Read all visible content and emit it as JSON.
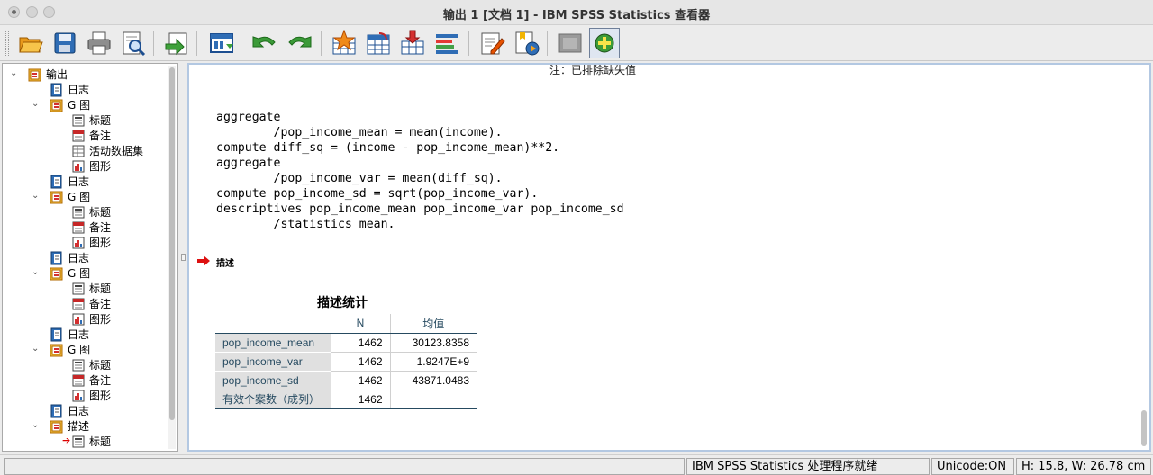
{
  "window": {
    "title": "输出 1 [文档 1] - IBM SPSS Statistics 查看器"
  },
  "toolbar": {
    "buttons": [
      {
        "name": "open-icon"
      },
      {
        "name": "save-icon"
      },
      {
        "name": "print-icon"
      },
      {
        "name": "print-preview-icon"
      },
      {
        "name": "export-icon"
      },
      {
        "name": "recall-dialog-icon"
      },
      {
        "name": "undo-icon"
      },
      {
        "name": "redo-icon"
      },
      {
        "name": "goto-data-icon"
      },
      {
        "name": "goto-case-icon"
      },
      {
        "name": "insert-variable-icon"
      },
      {
        "name": "variables-icon"
      },
      {
        "name": "edit-output-icon"
      },
      {
        "name": "run-script-icon"
      },
      {
        "name": "hide-icon"
      },
      {
        "name": "designate-window-icon"
      }
    ]
  },
  "tree": {
    "items": [
      {
        "label": "输出",
        "level": 0,
        "icon": "output-book-icon",
        "expanded": true
      },
      {
        "label": "日志",
        "level": 1,
        "icon": "log-icon"
      },
      {
        "label": "G 图",
        "level": 1,
        "icon": "output-book-icon",
        "expanded": true
      },
      {
        "label": "标题",
        "level": 2,
        "icon": "title-icon"
      },
      {
        "label": "备注",
        "level": 2,
        "icon": "notes-icon"
      },
      {
        "label": "活动数据集",
        "level": 2,
        "icon": "dataset-icon"
      },
      {
        "label": "图形",
        "level": 2,
        "icon": "chart-icon"
      },
      {
        "label": "日志",
        "level": 1,
        "icon": "log-icon"
      },
      {
        "label": "G 图",
        "level": 1,
        "icon": "output-book-icon",
        "expanded": true
      },
      {
        "label": "标题",
        "level": 2,
        "icon": "title-icon"
      },
      {
        "label": "备注",
        "level": 2,
        "icon": "notes-icon"
      },
      {
        "label": "图形",
        "level": 2,
        "icon": "chart-icon"
      },
      {
        "label": "日志",
        "level": 1,
        "icon": "log-icon"
      },
      {
        "label": "G 图",
        "level": 1,
        "icon": "output-book-icon",
        "expanded": true
      },
      {
        "label": "标题",
        "level": 2,
        "icon": "title-icon"
      },
      {
        "label": "备注",
        "level": 2,
        "icon": "notes-icon"
      },
      {
        "label": "图形",
        "level": 2,
        "icon": "chart-icon"
      },
      {
        "label": "日志",
        "level": 1,
        "icon": "log-icon"
      },
      {
        "label": "G 图",
        "level": 1,
        "icon": "output-book-icon",
        "expanded": true
      },
      {
        "label": "标题",
        "level": 2,
        "icon": "title-icon"
      },
      {
        "label": "备注",
        "level": 2,
        "icon": "notes-icon"
      },
      {
        "label": "图形",
        "level": 2,
        "icon": "chart-icon"
      },
      {
        "label": "日志",
        "level": 1,
        "icon": "log-icon"
      },
      {
        "label": "描述",
        "level": 1,
        "icon": "output-book-icon",
        "expanded": true
      },
      {
        "label": "标题",
        "level": 2,
        "icon": "title-icon",
        "current": true
      }
    ]
  },
  "output": {
    "top_note": "注：已排除缺失值",
    "syntax": "aggregate\n        /pop_income_mean = mean(income).\ncompute diff_sq = (income - pop_income_mean)**2.\naggregate\n        /pop_income_var = mean(diff_sq).\ncompute pop_income_sd = sqrt(pop_income_var).\ndescriptives pop_income_mean pop_income_var pop_income_sd\n        /statistics mean.",
    "heading": "描述",
    "table": {
      "title": "描述统计",
      "columns": [
        "",
        "N",
        "均值"
      ],
      "rows": [
        {
          "label": "pop_income_mean",
          "n": "1462",
          "mean": "30123.8358"
        },
        {
          "label": "pop_income_var",
          "n": "1462",
          "mean": "1.9247E+9"
        },
        {
          "label": "pop_income_sd",
          "n": "1462",
          "mean": "43871.0483"
        },
        {
          "label": "有效个案数（成列）",
          "n": "1462",
          "mean": ""
        }
      ]
    }
  },
  "status": {
    "message": "IBM SPSS Statistics 处理程序就绪",
    "encoding": "Unicode:ON",
    "dimensions": "H: 15.8, W: 26.78 cm"
  },
  "colors": {
    "table_header_text": "#264a60",
    "row_label_bg": "#e0e0e0",
    "pane_border": "#b3c8e2",
    "arrow_red": "#dd1111"
  }
}
